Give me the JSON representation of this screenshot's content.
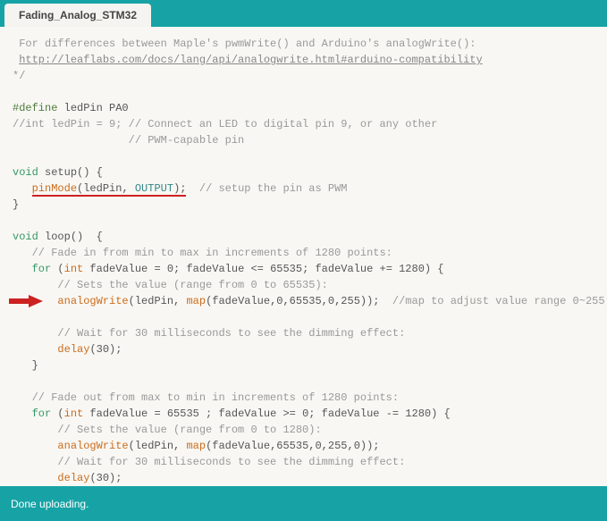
{
  "tab": {
    "title": "Fading_Analog_STM32"
  },
  "status": {
    "message": "Done uploading."
  },
  "code": {
    "c1": " For differences between Maple's pwmWrite() and Arduino's analogWrite():",
    "url": "http://leaflabs.com/docs/lang/api/analogwrite.html#arduino-compatibility",
    "c2": "*/",
    "define_kw": "#define",
    "define_rest": " ledPin PA0",
    "l4": "//int ledPin = 9; // Connect an LED to digital pin 9, or any other",
    "l5": "                  // PWM-capable pin",
    "void": "void",
    "setup": " setup",
    "paren_brace": "() {",
    "pinmode": "pinMode",
    "pinmode_args_open": "(ledPin, ",
    "output": "OUTPUT",
    "pinmode_args_close": ");",
    "setup_comment": "  // setup the pin as PWM",
    "brace_close": "}",
    "loop": " loop",
    "loop_paren": "()  {",
    "fadein_comment": "   // Fade in from min to max in increments of 1280 points:",
    "for": "for",
    "int": "int",
    "for_in": " fadeValue = 0; fadeValue <= 65535; fadeValue += 1280) {",
    "sets_comment": "       // Sets the value (range from 0 to 65535):",
    "analogWrite": "analogWrite",
    "aw_open": "(ledPin, ",
    "map": "map",
    "aw_args1": "(fadeValue,0,65535,0,255));",
    "map_comment": "  //map to adjust value range 0~255",
    "wait_comment": "       // Wait for 30 milliseconds to see the dimming effect:",
    "delay": "delay",
    "delay_args": "(30);",
    "inner_close": "   }",
    "fadeout_comment": "   // Fade out from max to min in increments of 1280 points:",
    "for_out": " fadeValue = 65535 ; fadeValue >= 0; fadeValue -= 1280) {",
    "sets_comment2": "       // Sets the value (range from 0 to 1280):",
    "aw_args2": "(fadeValue,65535,0,255,0));",
    "for_open": " ("
  }
}
